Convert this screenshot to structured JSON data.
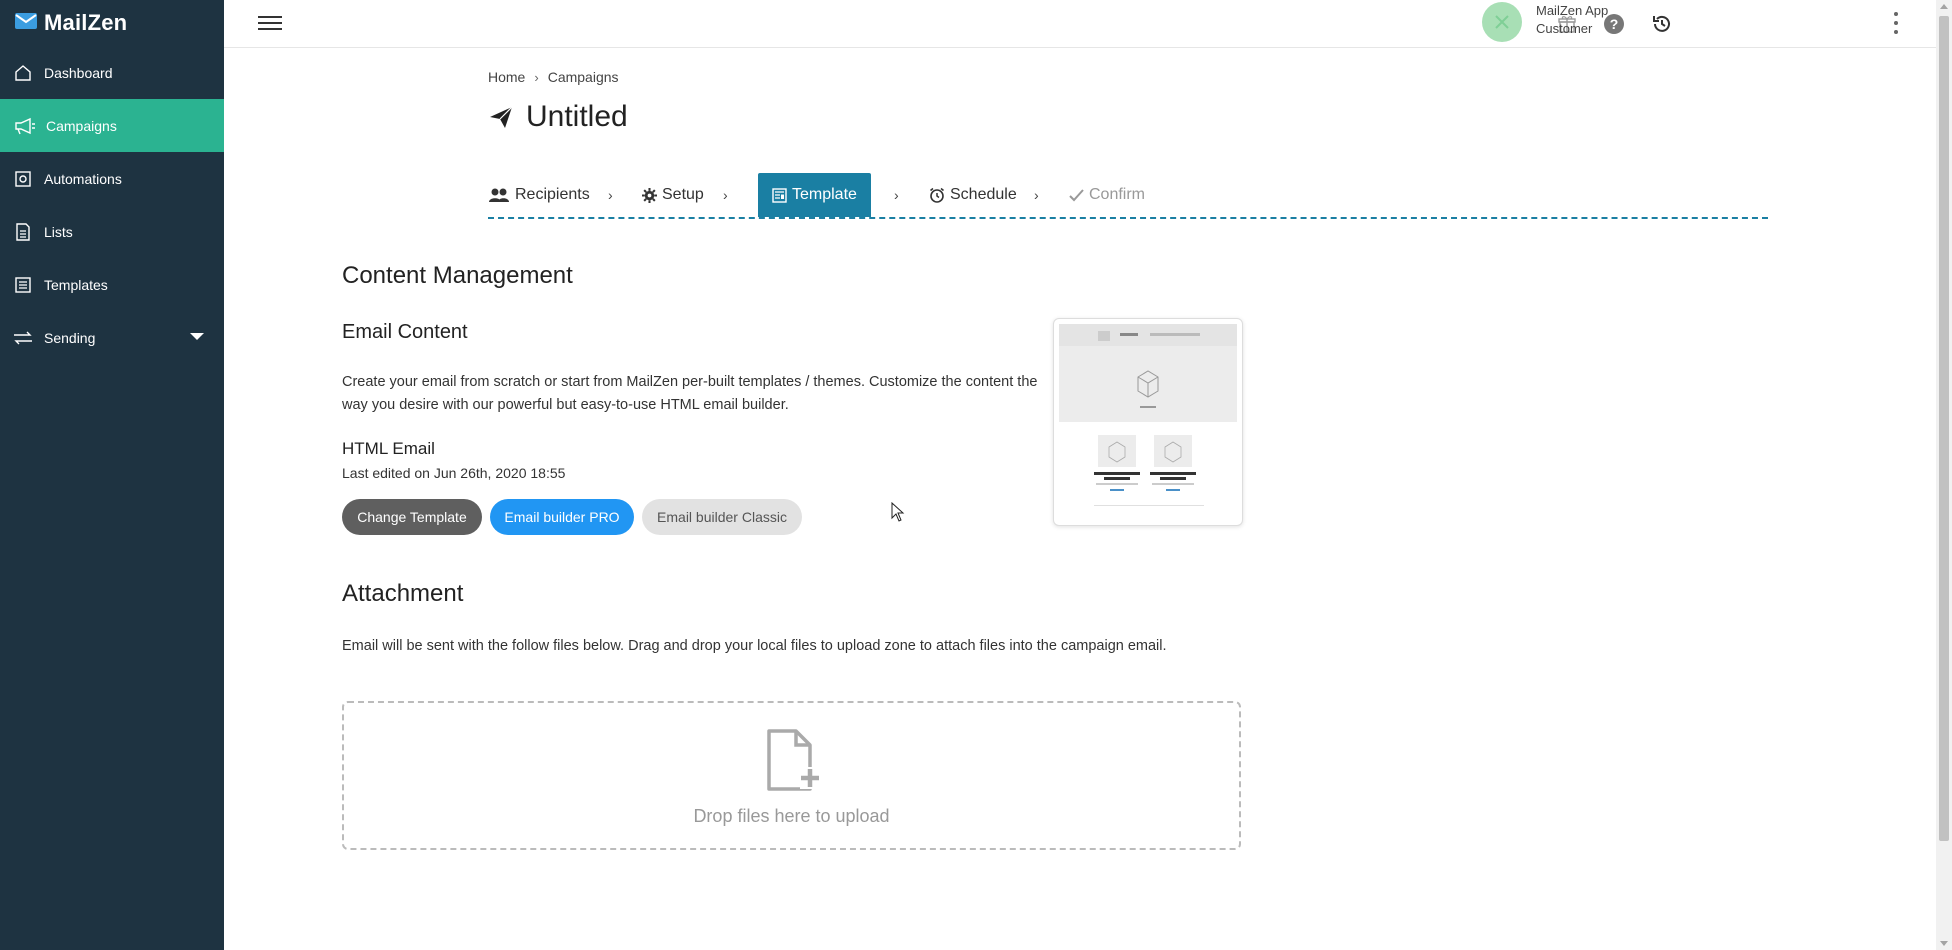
{
  "app": {
    "name": "MailZen"
  },
  "sidebar": {
    "items": [
      {
        "label": "Dashboard",
        "icon": "home-icon",
        "active": false
      },
      {
        "label": "Campaigns",
        "icon": "megaphone-icon",
        "active": true
      },
      {
        "label": "Automations",
        "icon": "automation-icon",
        "active": false
      },
      {
        "label": "Lists",
        "icon": "list-document-icon",
        "active": false
      },
      {
        "label": "Templates",
        "icon": "template-icon",
        "active": false
      },
      {
        "label": "Sending",
        "icon": "sending-arrows-icon",
        "active": false,
        "has_dropdown": true
      }
    ],
    "colors": {
      "background": "#1e3341",
      "active": "#2bb391"
    }
  },
  "topbar": {
    "icons": [
      "gift-icon",
      "help-icon",
      "history-icon"
    ],
    "user": {
      "name": "MailZen App",
      "role": "Customer"
    }
  },
  "breadcrumb": {
    "home": "Home",
    "current": "Campaigns"
  },
  "page": {
    "title": "Untitled"
  },
  "steps": [
    {
      "label": "Recipients",
      "icon": "users-icon",
      "state": "done"
    },
    {
      "label": "Setup",
      "icon": "gear-icon",
      "state": "done"
    },
    {
      "label": "Template",
      "icon": "template-icon",
      "state": "active"
    },
    {
      "label": "Schedule",
      "icon": "alarm-clock-icon",
      "state": "pending"
    },
    {
      "label": "Confirm",
      "icon": "check-icon",
      "state": "disabled"
    }
  ],
  "content": {
    "heading": "Content Management",
    "email_content": {
      "heading": "Email Content",
      "description": "Create your email from scratch or start from MailZen per-built templates / themes. Customize the content the way you desire with our powerful but easy-to-use HTML email builder.",
      "type_label": "HTML Email",
      "last_edited": "Last edited on Jun 26th, 2020 18:55",
      "buttons": {
        "change_template": "Change Template",
        "builder_pro": "Email builder PRO",
        "builder_classic": "Email builder Classic"
      }
    },
    "attachment": {
      "heading": "Attachment",
      "description": "Email will be sent with the follow files below. Drag and drop your local files to upload zone to attach files into the campaign email.",
      "dropzone_text": "Drop files here to upload"
    }
  },
  "accent_colors": {
    "step_active": "#1a7fa3",
    "button_pro": "#2196f3",
    "button_dark": "#5f5f5f"
  }
}
